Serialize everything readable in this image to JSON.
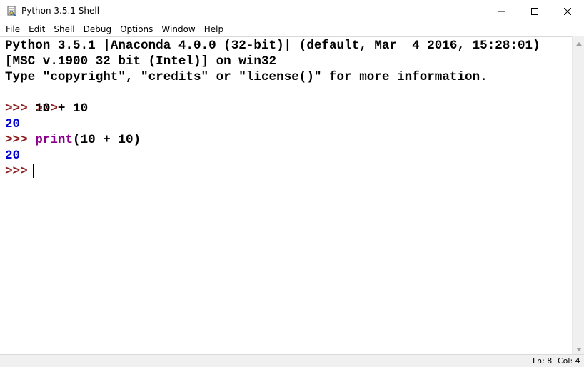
{
  "window": {
    "title": "Python 3.5.1 Shell",
    "icon": "python-idle-icon",
    "controls": [
      "minimize-icon",
      "maximize-icon",
      "close-icon"
    ]
  },
  "menu": {
    "items": [
      "File",
      "Edit",
      "Shell",
      "Debug",
      "Options",
      "Window",
      "Help"
    ]
  },
  "shell": {
    "banner": [
      "Python 3.5.1 |Anaconda 4.0.0 (32-bit)| (default, Mar  4 2016, 15:28:01)",
      "[MSC v.1900 32 bit (Intel)] on win32",
      "Type \"copyright\", \"credits\" or \"license()\" for more information."
    ],
    "prompt": ">>>",
    "cmd1": "10 + 10",
    "out1": "20",
    "cmd2_builtin": "print",
    "cmd2_rest": "(10 + 10)",
    "out2": "20"
  },
  "status": {
    "line": "Ln: 8",
    "col": "Col: 4"
  },
  "colors": {
    "prompt": "#8b1c1c",
    "output": "#0000cc",
    "builtin": "#8b008b"
  }
}
